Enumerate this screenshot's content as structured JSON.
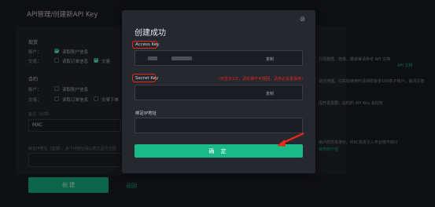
{
  "page": {
    "title": "API管理/创建新API Key",
    "spot": {
      "heading": "现货",
      "account_label": "账户：",
      "read_info": "读取账户信息",
      "trade_label": "交易：",
      "read_orders": "读取订单信息",
      "trade": "交易"
    },
    "contract": {
      "heading": "合约",
      "account_label": "账户：",
      "read_info": "读取账户信息",
      "trade_label": "交易：",
      "read_orders": "读取订单信息",
      "order_info": "订单信息",
      "trade_orders": "交易下单"
    },
    "note_label": "备注（必填）",
    "note_value": "MXC",
    "ip_hint": "绑定IP地址（选填），多个IP地址间以英文逗号分隔",
    "side_notes": [
      "行情数据、挂单、撤单等请参考 API 文档",
      "API 文档",
      "请勿泄露，在实际使用时请保密最多100条子账户，最请注意",
      "因开发需要，此时的 API Key 会授权",
      "用户的交易单价。MXC现货引入平台做市商计",
      "做市商介绍"
    ],
    "create_button": "创 建",
    "back_link": "返回"
  },
  "modal": {
    "title": "创建成功",
    "close_glyph": "⊗",
    "access_key_label": "Access Key",
    "secret_key_label": "Secret Key",
    "secret_warning": "（仅显示1次，请长期不可找回，请务必妥善保存）",
    "copy_label": "复制",
    "ip_label": "绑定IP地址",
    "confirm_button": "确 定"
  },
  "colors": {
    "accent": "#19b886",
    "highlight_red": "#e8261b",
    "background": "#1b1d22",
    "modal": "#25282e"
  }
}
